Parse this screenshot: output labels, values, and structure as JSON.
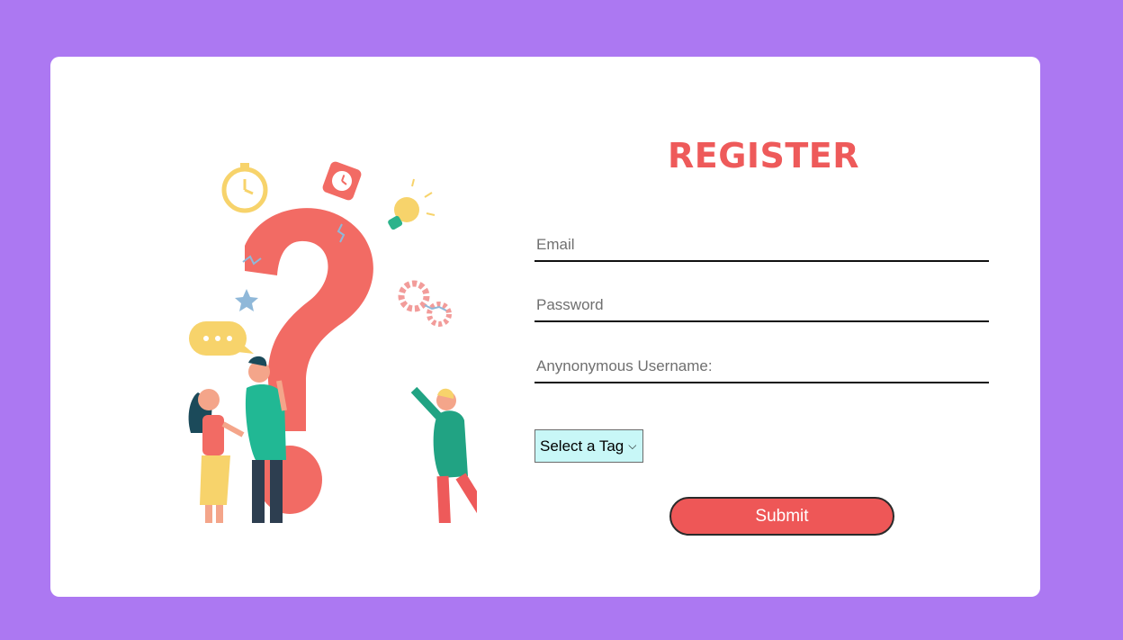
{
  "form": {
    "title": "REGISTER",
    "email_placeholder": "Email",
    "password_placeholder": "Password",
    "username_placeholder": "Anynonymous Username:",
    "tag_selected": "Select a Tag",
    "submit_label": "Submit"
  },
  "illustration": {
    "icon": "question-mark-people-illustration"
  },
  "colors": {
    "page_background": "#ac78f2",
    "card_background": "#ffffff",
    "title": "#ee5a5a",
    "submit_background": "#ee5757",
    "select_background": "#c8f7f7"
  }
}
